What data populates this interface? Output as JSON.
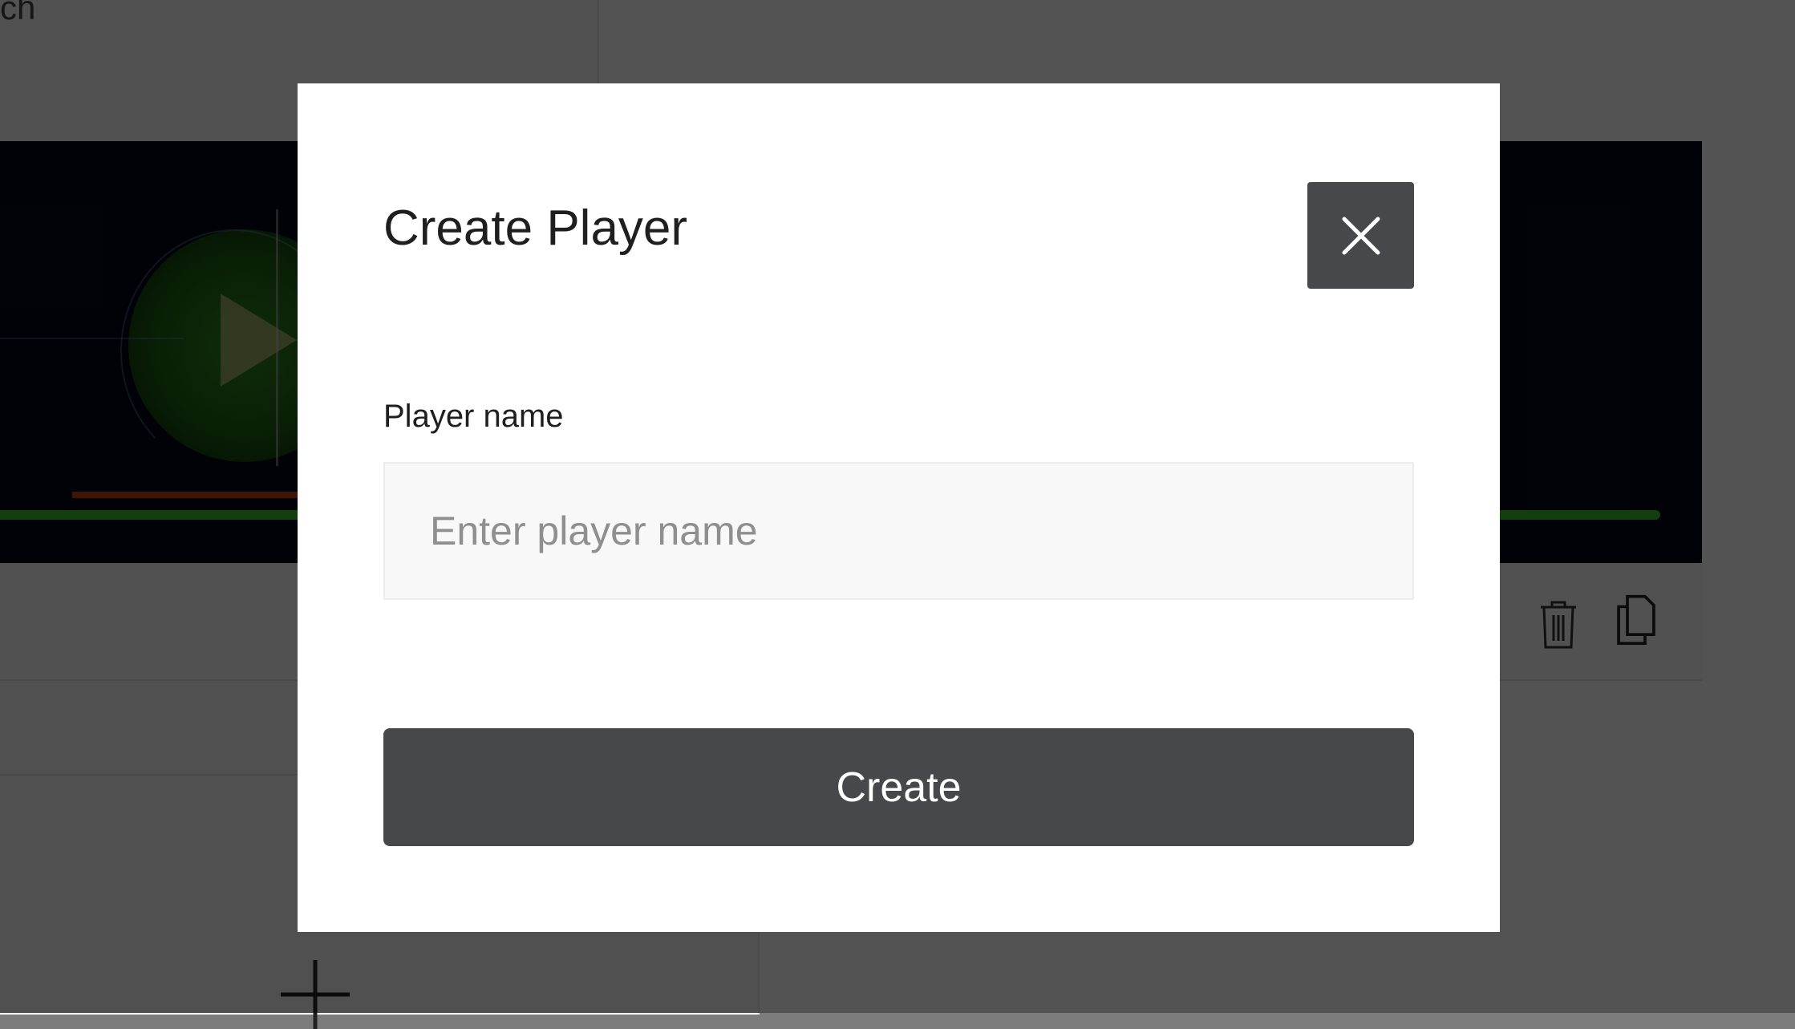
{
  "background": {
    "search_text": "ch"
  },
  "modal": {
    "title": "Create Player",
    "field_label": "Player name",
    "input": {
      "value": "",
      "placeholder": "Enter player name"
    },
    "submit_label": "Create"
  },
  "icons": {
    "close": "close-icon",
    "trash": "trash-icon",
    "copy": "copy-icon",
    "add": "plus-icon"
  },
  "colors": {
    "overlay": "rgba(0,0,0,0.675)",
    "button_bg": "#47484c",
    "modal_bg": "#ffffff",
    "input_bg": "#f8f8f8"
  }
}
